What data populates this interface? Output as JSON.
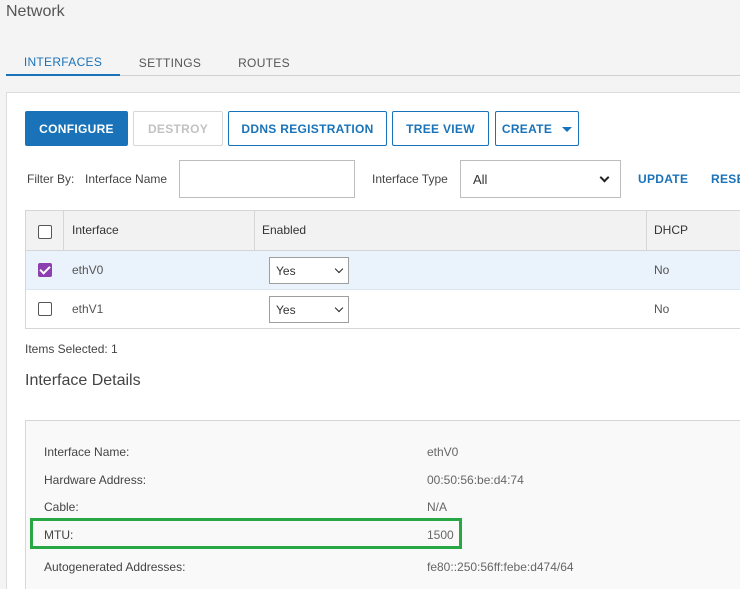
{
  "page": {
    "title": "Network"
  },
  "tabs": [
    {
      "label": "INTERFACES",
      "active": true
    },
    {
      "label": "SETTINGS",
      "active": false
    },
    {
      "label": "ROUTES",
      "active": false
    }
  ],
  "toolbar": {
    "configure": "CONFIGURE",
    "destroy": "DESTROY",
    "ddns": "DDNS REGISTRATION",
    "tree_view": "TREE VIEW",
    "create": "CREATE"
  },
  "filter": {
    "filter_by": "Filter By:",
    "interface_name_label": "Interface Name",
    "interface_name_value": "",
    "interface_type_label": "Interface Type",
    "interface_type_value": "All",
    "update": "UPDATE",
    "reset": "RESET"
  },
  "table": {
    "columns": [
      "Interface",
      "Enabled",
      "DHCP"
    ],
    "rows": [
      {
        "checked": true,
        "interface": "ethV0",
        "enabled": "Yes",
        "dhcp": "No"
      },
      {
        "checked": false,
        "interface": "ethV1",
        "enabled": "Yes",
        "dhcp": "No"
      }
    ]
  },
  "items_selected": "Items Selected: 1",
  "details": {
    "title": "Interface Details",
    "rows": [
      {
        "label": "Interface Name:",
        "value": "ethV0"
      },
      {
        "label": "Hardware Address:",
        "value": "00:50:56:be:d4:74"
      },
      {
        "label": "Cable:",
        "value": "N/A"
      },
      {
        "label": "MTU:",
        "value": "1500"
      },
      {
        "label": "Autogenerated Addresses:",
        "value": "fe80::250:56ff:febe:d474/64"
      }
    ]
  },
  "colors": {
    "accent": "#1a73b8",
    "checkbox_checked": "#8d3fb0",
    "highlight_box": "#27a844",
    "selected_row": "#eaf2fb"
  }
}
